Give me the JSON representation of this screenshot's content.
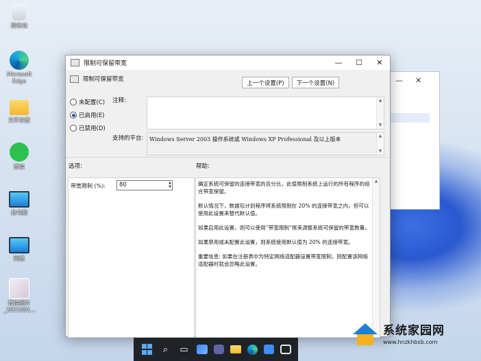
{
  "desktop": {
    "icons": [
      {
        "label": "回收站",
        "icon": "recycle-bin-icon"
      },
      {
        "label": "Microsoft Edge",
        "icon": "edge-icon"
      },
      {
        "label": "文件存放",
        "icon": "folder-icon"
      },
      {
        "label": "微信",
        "icon": "wechat-icon"
      },
      {
        "label": "此电脑",
        "icon": "this-pc-icon"
      },
      {
        "label": "网络",
        "icon": "network-icon"
      },
      {
        "label": "微信图片_2021091...",
        "icon": "image-file-icon"
      }
    ]
  },
  "background_window": {
    "minimize": "—",
    "close": "✕"
  },
  "dialog": {
    "title": "限制可保留带宽",
    "controls": {
      "minimize": "—",
      "maximize": "☐",
      "close": "✕"
    },
    "header_title": "限制可保留带宽",
    "prev_button": "上一个设置(P)",
    "next_button": "下一个设置(N)",
    "radio_options": [
      {
        "label": "未配置(C)",
        "selected": false
      },
      {
        "label": "已启用(E)",
        "selected": true
      },
      {
        "label": "已禁用(D)",
        "selected": false
      }
    ],
    "comment_label": "注释:",
    "comment_value": "",
    "platform_label": "支持的平台:",
    "platform_value": "Windows Server 2003 操作系统或 Windows XP Professional 及以上版本",
    "options_label": "选项:",
    "help_label": "帮助:",
    "bandwidth_label": "带宽限制 (%):",
    "bandwidth_value": "80",
    "help_paragraphs": [
      "确定系统可保留的连接带宽的百分比。此值限制系统上运行的所有程序的组合带宽保留。",
      "默认情况下，数据包计划程序将系统限制在 20% 的连接带宽之内，但可以使用此设置来替代默认值。",
      "如果启用此设置，则可以使用“带宽限制”框来调整系统可保留的带宽数量。",
      "如果禁用或未配置此设置，则系统使用默认值为 20% 的连接带宽。",
      "重要信息: 如果在注册表中为特定网络适配器设置带宽限制，则配置该网络适配器时就会忽略此设置。"
    ]
  },
  "taskbar": {
    "items": [
      "windows-start-icon",
      "search-icon",
      "task-view-icon",
      "widgets-icon",
      "chat-icon",
      "file-explorer-icon",
      "edge-icon",
      "store-icon",
      "snipping-icon"
    ]
  },
  "watermark": {
    "name": "系统家园网",
    "url": "www.hnzkhbsb.com"
  }
}
